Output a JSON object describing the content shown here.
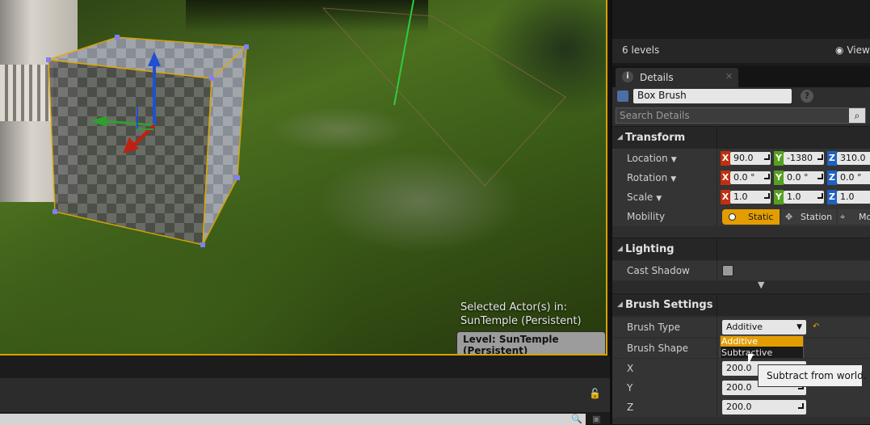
{
  "viewport": {
    "selected_actors_line1": "Selected Actor(s) in:",
    "selected_actors_line2": "SunTemple (Persistent)",
    "level_badge": "Level:  SunTemple (Persistent)"
  },
  "levels": {
    "count_label": "6 levels",
    "view_options_label": "View"
  },
  "details_tab": {
    "label": "Details",
    "close_icon": "close-icon"
  },
  "actor": {
    "name": "Box Brush",
    "help_icon": "help-icon"
  },
  "search": {
    "placeholder": "Search Details"
  },
  "transform": {
    "title": "Transform",
    "location": {
      "label": "Location",
      "x": "90.0",
      "y": "-1380",
      "z": "310.0"
    },
    "rotation": {
      "label": "Rotation",
      "x": "0.0 °",
      "y": "0.0 °",
      "z": "0.0 °"
    },
    "scale": {
      "label": "Scale",
      "x": "1.0",
      "y": "1.0",
      "z": "1.0"
    },
    "mobility": {
      "label": "Mobility",
      "static": "Static",
      "stationary": "Station",
      "movable": "Mo"
    }
  },
  "axis_labels": {
    "x": "X",
    "y": "Y",
    "z": "Z"
  },
  "lighting": {
    "title": "Lighting",
    "cast_shadow_label": "Cast Shadow"
  },
  "brush_settings": {
    "title": "Brush Settings",
    "brush_type_label": "Brush Type",
    "brush_type_value": "Additive",
    "brush_shape_label": "Brush Shape",
    "x_label": "X",
    "x_value": "200.0",
    "y_label": "Y",
    "y_value": "200.0",
    "z_label": "Z",
    "z_value": "200.0"
  },
  "brush_type_dropdown": {
    "options": [
      "Additive",
      "Subtractive"
    ],
    "selected": "Additive"
  },
  "tooltip": "Subtract from world.",
  "colors": {
    "selection_orange": "#d9a000",
    "mobility_static": "#e39d00",
    "axis_x": "#c03010",
    "axis_y": "#55a020",
    "axis_z": "#2060c0"
  }
}
